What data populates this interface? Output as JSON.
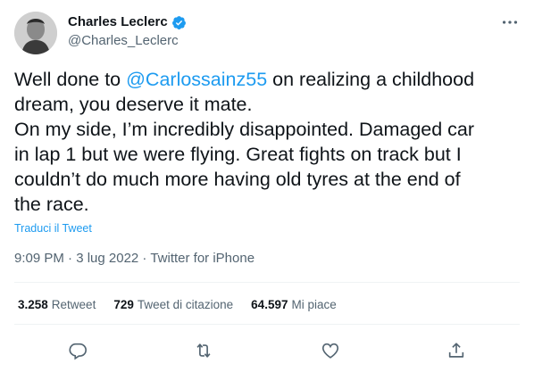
{
  "author": {
    "display_name": "Charles Leclerc",
    "handle": "@Charles_Leclerc",
    "verified": true
  },
  "tweet": {
    "text_before_mention": "Well done to ",
    "mention": "@Carlossainz55",
    "text_after_mention": " on realizing a childhood\ndream, you deserve it mate.\nOn my side, I’m incredibly disappointed. Damaged car\nin lap 1 but we were flying. Great fights on track but I\ncouldn’t do much more having old tyres at the end of\nthe race.",
    "translate_label": "Traduci il Tweet",
    "meta": "9:09 PM · 3 lug 2022 · Twitter for iPhone"
  },
  "stats": [
    {
      "count": "3.258",
      "label": "Retweet"
    },
    {
      "count": "729",
      "label": "Tweet di citazione"
    },
    {
      "count": "64.597",
      "label": "Mi piace"
    }
  ],
  "icons": {
    "more": "more-icon",
    "reply": "reply-icon",
    "retweet": "retweet-icon",
    "like": "like-icon",
    "share": "share-icon",
    "verified": "verified-badge-icon"
  },
  "colors": {
    "accent": "#1d9bf0",
    "secondary_text": "#536471",
    "primary_text": "#0f1419",
    "divider": "#eff3f4"
  }
}
